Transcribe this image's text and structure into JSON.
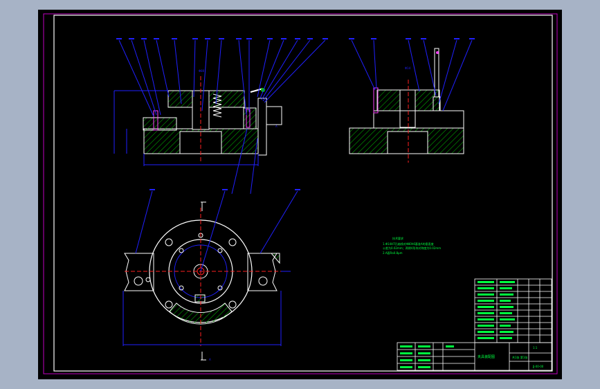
{
  "drawing": {
    "tech_requirements": {
      "heading": "技术要求",
      "lines": [
        "1.Φ14H7孔轴线对Φ80h6基准A的垂直度",
        "公差为0.02mm；两侧V形块对称度为0.02mm",
        "2.A面Ra0.8μm"
      ]
    },
    "dimension_labels": {
      "side_view_top": "Φ80",
      "side_view_label": "A",
      "right_view_top": "Φ14",
      "bottom_dim": "A"
    },
    "title_block": {
      "drawing_name": "夹具装配图",
      "drawing_number": "JJ-00-00",
      "scale_text": "1:1",
      "sheet_text": "共1张 第1张"
    }
  },
  "colors": {
    "frame_magenta": "#c000c0",
    "line_white": "#ffffff",
    "leader_blue": "#2020ff",
    "hatch_green": "#00c000",
    "center_red": "#ff2020",
    "table_green": "#00ff40",
    "part_yellow": "#ffff00"
  }
}
